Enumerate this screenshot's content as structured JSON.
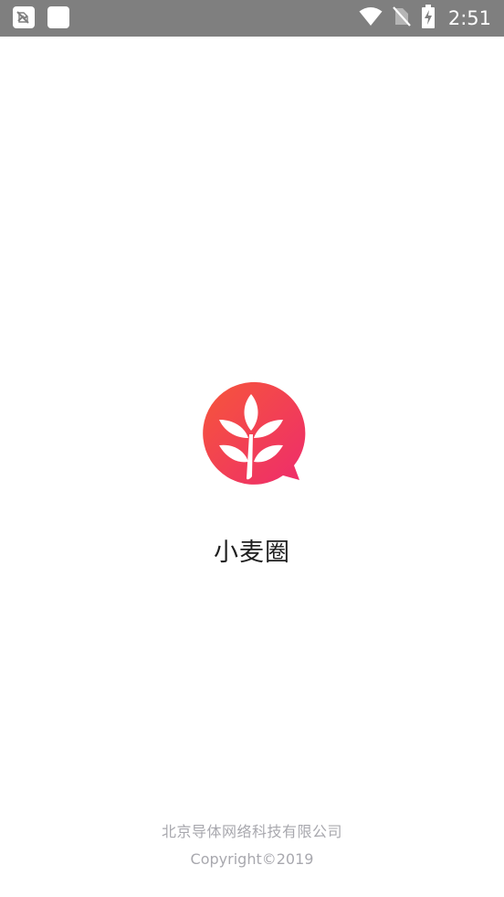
{
  "status_bar": {
    "time": "2:51",
    "left_icons": [
      "no-sim-notification-icon",
      "app-notification-icon"
    ],
    "right_icons": [
      "wifi-icon",
      "no-signal-icon",
      "battery-charging-icon"
    ],
    "background": "#7f7f7f"
  },
  "splash": {
    "logo_icon": "wheat-speech-bubble-icon",
    "app_name": "小麦圈",
    "logo_gradient": [
      "#f6533b",
      "#f0306a"
    ]
  },
  "footer": {
    "company": "北京导体网络科技有限公司",
    "copyright": "Copyright©2019"
  }
}
